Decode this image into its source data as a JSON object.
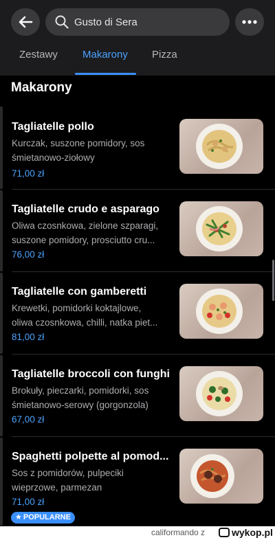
{
  "header": {
    "search_text": "Gusto di Sera"
  },
  "tabs": [
    {
      "label": "Zestawy"
    },
    {
      "label": "Makarony"
    },
    {
      "label": "Pizza"
    }
  ],
  "section": {
    "title": "Makarony"
  },
  "items": [
    {
      "name": "Tagliatelle pollo",
      "desc": [
        "Kurczak, suszone pomidory, sos",
        "śmietanowo-ziołowy"
      ],
      "price": "71,00 zł"
    },
    {
      "name": "Tagliatelle crudo e asparago",
      "desc": [
        "Oliwa czosnkowa, zielone szparagi,",
        "suszone pomidory, prosciutto cru..."
      ],
      "price": "76,00 zł"
    },
    {
      "name": "Tagliatelle con gamberetti",
      "desc": [
        "Krewetki, pomidorki koktajlowe,",
        "oliwa czosnkowa, chilli, natka piet..."
      ],
      "price": "81,00 zł"
    },
    {
      "name": "Tagliatelle broccoli con funghi",
      "desc": [
        "Brokuły, pieczarki, pomidorki, sos",
        "śmietanowo-serowy (gorgonzola)"
      ],
      "price": "67,00 zł"
    },
    {
      "name": "Spaghetti polpette al pomod...",
      "desc": [
        "Sos z pomidorów, pulpeciki",
        "wieprzowe, parmezan"
      ],
      "price": "71,00 zł",
      "badge": "POPULARNE"
    }
  ],
  "footer": {
    "user": "califormando",
    "user_prefix": "z",
    "brand": "wykop.pl"
  },
  "colors": {
    "accent": "#3a8fff",
    "price": "#4aa3ff",
    "background": "#000000"
  }
}
